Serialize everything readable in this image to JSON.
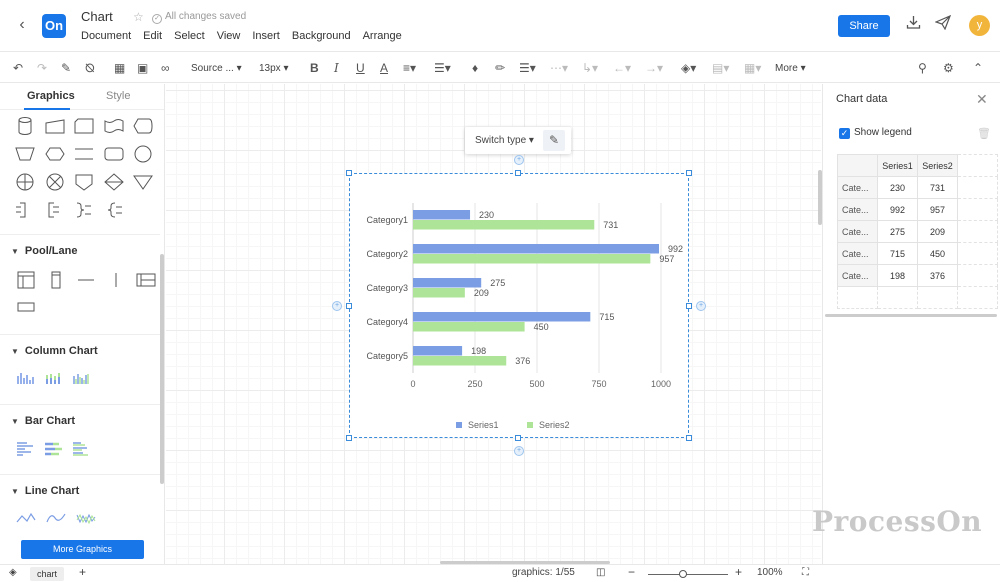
{
  "header": {
    "title": "Chart",
    "saved_status": "All changes saved",
    "menu": [
      "Document",
      "Edit",
      "Select",
      "View",
      "Insert",
      "Background",
      "Arrange"
    ],
    "share_label": "Share",
    "avatar_initial": "y",
    "logo_text": "On"
  },
  "toolbar": {
    "font_name": "Source ...",
    "font_size": "13px",
    "more_label": "More"
  },
  "left_panel": {
    "tabs": [
      "Graphics",
      "Style"
    ],
    "sections": [
      "Pool/Lane",
      "Column Chart",
      "Bar Chart",
      "Line Chart"
    ],
    "more_graphics_label": "More Graphics"
  },
  "popover": {
    "switch_type_label": "Switch type"
  },
  "right_panel": {
    "title": "Chart data",
    "show_legend_label": "Show legend",
    "show_legend_checked": true,
    "table_headers": [
      "Series1",
      "Series2"
    ],
    "table_rows": [
      {
        "cat": "Cate...",
        "s1": "230",
        "s2": "731"
      },
      {
        "cat": "Cate...",
        "s1": "992",
        "s2": "957"
      },
      {
        "cat": "Cate...",
        "s1": "275",
        "s2": "209"
      },
      {
        "cat": "Cate...",
        "s1": "715",
        "s2": "450"
      },
      {
        "cat": "Cate...",
        "s1": "198",
        "s2": "376"
      }
    ]
  },
  "watermark": "ProcessOn",
  "bottom_bar": {
    "page_tab": "chart",
    "graphics_count": "graphics:  1/55",
    "zoom": "100%"
  },
  "colors": {
    "accent": "#1976e8",
    "series1": "#7b9de4",
    "series2": "#ade497"
  },
  "chart_data": {
    "type": "bar",
    "orientation": "horizontal",
    "categories": [
      "Category1",
      "Category2",
      "Category3",
      "Category4",
      "Category5"
    ],
    "series": [
      {
        "name": "Series1",
        "values": [
          230,
          992,
          275,
          715,
          198
        ],
        "color": "#7b9de4"
      },
      {
        "name": "Series2",
        "values": [
          731,
          957,
          209,
          450,
          376
        ],
        "color": "#ade497"
      }
    ],
    "xlim": [
      0,
      1000
    ],
    "xticks": [
      "0",
      "250",
      "500",
      "750",
      "1000"
    ],
    "grid": true,
    "legend": "bottom"
  }
}
